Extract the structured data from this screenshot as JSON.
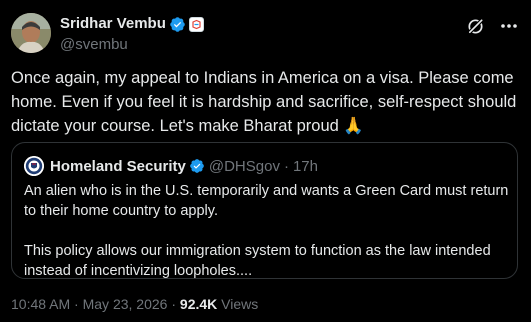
{
  "author": {
    "display_name": "Sridhar Vembu",
    "handle": "@svembu",
    "verified": true,
    "affiliation_icon": "company-affiliation-badge",
    "avatar_icon": "profile-avatar"
  },
  "actions": {
    "grok_icon": "grok-icon",
    "more_icon": "more-options-icon"
  },
  "tweet": {
    "text": "Once again, my appeal to Indians in America on a visa. Please come home. Even if you feel it is hardship and sacrifice, self-respect should dictate your course. Let's make Bharat proud 🙏"
  },
  "quoted_tweet": {
    "display_name": "Homeland Security",
    "handle": "@DHSgov",
    "separator": "·",
    "time": "17h",
    "verified": true,
    "avatar_icon": "dhs-seal-avatar",
    "paragraph_1": "An alien who is in the U.S. temporarily and wants a Green Card must return to their home country to apply.",
    "paragraph_2": "This policy allows our immigration system to function as the law intended instead of incentivizing loopholes...."
  },
  "meta": {
    "time": "10:48 AM",
    "separator_1": " · ",
    "date": "May 23, 2026",
    "separator_2": " · ",
    "views_count": "92.4K",
    "views_label": " Views"
  },
  "colors": {
    "background": "#000000",
    "text": "#e7e9ea",
    "secondary_text": "#71767b",
    "verified_blue": "#1d9bf0",
    "border": "#2f3336"
  }
}
